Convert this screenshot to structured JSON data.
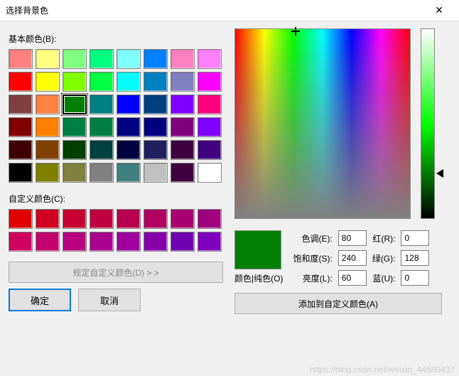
{
  "title": "选择背景色",
  "close_glyph": "✕",
  "labels": {
    "basic": "基本颜色(B):",
    "custom": "自定义颜色(C):",
    "define": "规定自定义颜色(D) > >",
    "ok": "确定",
    "cancel": "取消",
    "solid": "颜色|纯色(O)",
    "hue": "色调(E):",
    "sat": "饱和度(S):",
    "lum": "亮度(L):",
    "red": "红(R):",
    "green": "绿(G):",
    "blue": "蓝(U):",
    "add": "添加到自定义颜色(A)"
  },
  "values": {
    "hue": "80",
    "sat": "240",
    "lum": "60",
    "red": "0",
    "green": "128",
    "blue": "0"
  },
  "preview_color": "#008000",
  "selected_basic_index": 18,
  "basic_colors": [
    "#ff8080",
    "#ffff80",
    "#80ff80",
    "#00ff80",
    "#80ffff",
    "#0080ff",
    "#ff80c0",
    "#ff80ff",
    "#ff0000",
    "#ffff00",
    "#80ff00",
    "#00ff40",
    "#00ffff",
    "#0080c0",
    "#8080c0",
    "#ff00ff",
    "#804040",
    "#ff8040",
    "#008000",
    "#008080",
    "#0000ff",
    "#004080",
    "#8000ff",
    "#ff0080",
    "#800000",
    "#ff8000",
    "#008040",
    "#008040",
    "#000080",
    "#000080",
    "#800080",
    "#8000ff",
    "#400000",
    "#804000",
    "#004000",
    "#004040",
    "#000040",
    "#202060",
    "#400040",
    "#400080",
    "#000000",
    "#808000",
    "#808040",
    "#808080",
    "#408080",
    "#c0c0c0",
    "#400040",
    "#ffffff"
  ],
  "custom_colors": [
    "#e00000",
    "#d00020",
    "#c80030",
    "#c00040",
    "#b80050",
    "#b00060",
    "#a80070",
    "#a00080",
    "#d00060",
    "#c40070",
    "#b80080",
    "#ac0090",
    "#a000a0",
    "#8800a8",
    "#7000b0",
    "#8000c0"
  ],
  "watermark": "https://blog.csdn.net/weixin_44580437"
}
